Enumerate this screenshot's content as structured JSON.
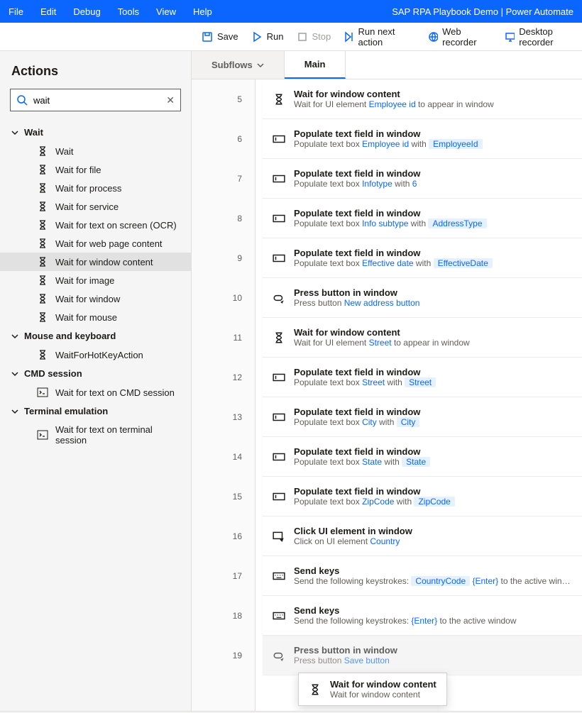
{
  "title": "SAP RPA Playbook Demo | Power Automate",
  "menu": [
    "File",
    "Edit",
    "Debug",
    "Tools",
    "View",
    "Help"
  ],
  "toolbar": [
    {
      "id": "save",
      "label": "Save"
    },
    {
      "id": "run",
      "label": "Run"
    },
    {
      "id": "stop",
      "label": "Stop",
      "disabled": true
    },
    {
      "id": "next",
      "label": "Run next action"
    },
    {
      "id": "web",
      "label": "Web recorder"
    },
    {
      "id": "desk",
      "label": "Desktop recorder"
    }
  ],
  "sidebar": {
    "title": "Actions",
    "search_value": "wait",
    "search_placeholder": "Search actions",
    "groups": [
      {
        "name": "Wait",
        "items": [
          "Wait",
          "Wait for file",
          "Wait for process",
          "Wait for service",
          "Wait for text on screen (OCR)",
          "Wait for web page content",
          "Wait for window content",
          "Wait for image",
          "Wait for window",
          "Wait for mouse"
        ],
        "highlight": 6,
        "icon": "hourglass"
      },
      {
        "name": "Mouse and keyboard",
        "items": [
          "WaitForHotKeyAction"
        ],
        "icon": "hourglass"
      },
      {
        "name": "CMD session",
        "items": [
          "Wait for text on CMD session"
        ],
        "icon": "cmd"
      },
      {
        "name": "Terminal emulation",
        "items": [
          "Wait for text on terminal session"
        ],
        "icon": "term"
      }
    ]
  },
  "tabs": {
    "subflows": "Subflows",
    "main": "Main"
  },
  "steps": [
    {
      "n": 5,
      "icon": "hourglass",
      "title": "Wait for window content",
      "desc": [
        [
          "txt",
          "Wait for UI element "
        ],
        [
          "link",
          "Employee id"
        ],
        [
          "txt",
          " to appear in window"
        ]
      ]
    },
    {
      "n": 6,
      "icon": "textbox",
      "title": "Populate text field in window",
      "desc": [
        [
          "txt",
          "Populate text box "
        ],
        [
          "link",
          "Employee id"
        ],
        [
          "txt",
          " with  "
        ],
        [
          "chip",
          "EmployeeId"
        ]
      ]
    },
    {
      "n": 7,
      "icon": "textbox",
      "title": "Populate text field in window",
      "desc": [
        [
          "txt",
          "Populate text box "
        ],
        [
          "link",
          "Infotype"
        ],
        [
          "txt",
          " with "
        ],
        [
          "link",
          "6"
        ]
      ]
    },
    {
      "n": 8,
      "icon": "textbox",
      "title": "Populate text field in window",
      "desc": [
        [
          "txt",
          "Populate text box "
        ],
        [
          "link",
          "Info subtype"
        ],
        [
          "txt",
          " with  "
        ],
        [
          "chip",
          "AddressType"
        ]
      ]
    },
    {
      "n": 9,
      "icon": "textbox",
      "title": "Populate text field in window",
      "desc": [
        [
          "txt",
          "Populate text box "
        ],
        [
          "link",
          "Effective date"
        ],
        [
          "txt",
          " with  "
        ],
        [
          "chip",
          "EffectiveDate"
        ]
      ]
    },
    {
      "n": 10,
      "icon": "press",
      "title": "Press button in window",
      "desc": [
        [
          "txt",
          "Press button "
        ],
        [
          "link",
          "New address button"
        ]
      ]
    },
    {
      "n": 11,
      "icon": "hourglass",
      "title": "Wait for window content",
      "desc": [
        [
          "txt",
          "Wait for UI element "
        ],
        [
          "link",
          "Street"
        ],
        [
          "txt",
          " to appear in window"
        ]
      ]
    },
    {
      "n": 12,
      "icon": "textbox",
      "title": "Populate text field in window",
      "desc": [
        [
          "txt",
          "Populate text box "
        ],
        [
          "link",
          "Street"
        ],
        [
          "txt",
          " with  "
        ],
        [
          "chip",
          "Street"
        ]
      ]
    },
    {
      "n": 13,
      "icon": "textbox",
      "title": "Populate text field in window",
      "desc": [
        [
          "txt",
          "Populate text box "
        ],
        [
          "link",
          "City"
        ],
        [
          "txt",
          " with  "
        ],
        [
          "chip",
          "City"
        ]
      ]
    },
    {
      "n": 14,
      "icon": "textbox",
      "title": "Populate text field in window",
      "desc": [
        [
          "txt",
          "Populate text box "
        ],
        [
          "link",
          "State"
        ],
        [
          "txt",
          " with  "
        ],
        [
          "chip",
          "State"
        ]
      ]
    },
    {
      "n": 15,
      "icon": "textbox",
      "title": "Populate text field in window",
      "desc": [
        [
          "txt",
          "Populate text box "
        ],
        [
          "link",
          "ZipCode"
        ],
        [
          "txt",
          " with  "
        ],
        [
          "chip",
          "ZipCode"
        ]
      ]
    },
    {
      "n": 16,
      "icon": "click",
      "title": "Click UI element in window",
      "desc": [
        [
          "txt",
          "Click on UI element "
        ],
        [
          "link",
          "Country"
        ]
      ]
    },
    {
      "n": 17,
      "icon": "keys",
      "title": "Send keys",
      "desc": [
        [
          "txt",
          "Send the following keystrokes:  "
        ],
        [
          "chip",
          "CountryCode"
        ],
        [
          "txt",
          "  "
        ],
        [
          "link",
          "{Enter}"
        ],
        [
          "txt",
          " to the active window"
        ]
      ]
    },
    {
      "n": 18,
      "icon": "keys",
      "title": "Send keys",
      "desc": [
        [
          "txt",
          "Send the following keystrokes: "
        ],
        [
          "link",
          "{Enter}"
        ],
        [
          "txt",
          " to the active window"
        ]
      ]
    },
    {
      "n": 19,
      "icon": "press",
      "title": "Press button in window",
      "desc": [
        [
          "txt",
          "Press button "
        ],
        [
          "link",
          "Save button"
        ]
      ],
      "dim": true
    }
  ],
  "tooltip": {
    "title": "Wait for window content",
    "sub": "Wait for window content"
  }
}
